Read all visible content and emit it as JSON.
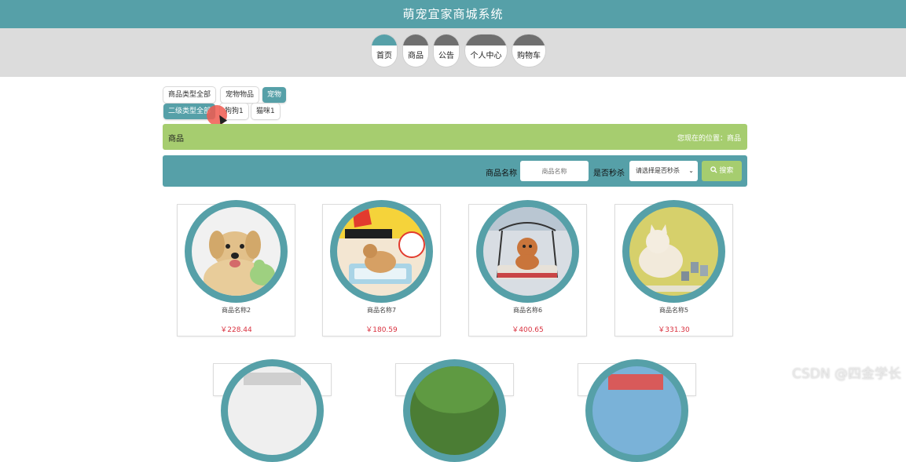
{
  "header": {
    "title": "萌宠宜家商城系统"
  },
  "nav": {
    "items": [
      {
        "label": "首页",
        "active": true
      },
      {
        "label": "商品",
        "active": false
      },
      {
        "label": "公告",
        "active": false
      },
      {
        "label": "个人中心",
        "active": false
      },
      {
        "label": "购物车",
        "active": false
      }
    ]
  },
  "filters": {
    "primary": [
      {
        "label": "商品类型全部",
        "selected": false
      },
      {
        "label": "宠物物品",
        "selected": false
      },
      {
        "label": "宠物",
        "selected": true
      }
    ],
    "secondary": [
      {
        "label": "二级类型全部",
        "selected": true
      },
      {
        "label": "狗狗1",
        "selected": false
      },
      {
        "label": "猫咪1",
        "selected": false
      }
    ]
  },
  "breadcrumb": {
    "title": "商品",
    "location": "您现在的位置：商品"
  },
  "search": {
    "name_label": "商品名称",
    "name_placeholder": "商品名称",
    "seckill_label": "是否秒杀",
    "seckill_value": "请选择是否秒杀",
    "button_label": "搜索"
  },
  "products": [
    {
      "name": "商品名称2",
      "price": "￥228.44",
      "image": "golden-retriever-with-toy"
    },
    {
      "name": "商品名称7",
      "price": "￥180.59",
      "image": "dog-pee-pad-ad"
    },
    {
      "name": "商品名称6",
      "price": "￥400.65",
      "image": "poodle-on-swing-bed"
    },
    {
      "name": "商品名称5",
      "price": "￥331.30",
      "image": "cat-with-cans"
    }
  ],
  "watermark": "CSDN @四金学长",
  "colors": {
    "primary": "#56a0a8",
    "accent": "#a6cd6f",
    "price": "#d9303e",
    "nav_bg": "#dcdcdc"
  }
}
